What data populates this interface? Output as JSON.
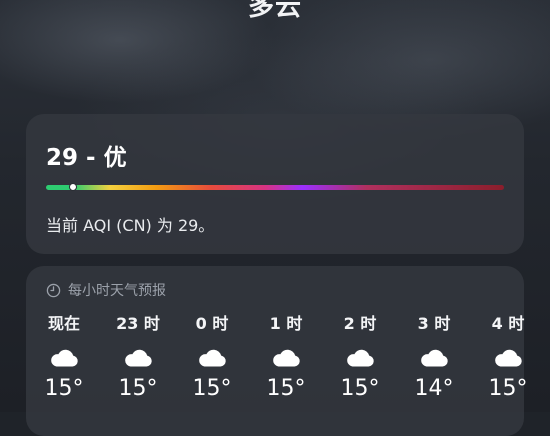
{
  "header": {
    "condition": "多云"
  },
  "aqi": {
    "title": "29 - 优",
    "value": 29,
    "scale_max": 500,
    "description": "当前 AQI (CN) 为 29。"
  },
  "hourly": {
    "header_icon": "clock-icon",
    "title": "每小时天气预报",
    "items": [
      {
        "label": "现在",
        "icon": "cloud-icon",
        "temp": "15°"
      },
      {
        "label": "23 时",
        "icon": "cloud-icon",
        "temp": "15°"
      },
      {
        "label": "0 时",
        "icon": "cloud-icon",
        "temp": "15°"
      },
      {
        "label": "1 时",
        "icon": "cloud-icon",
        "temp": "15°"
      },
      {
        "label": "2 时",
        "icon": "cloud-icon",
        "temp": "15°"
      },
      {
        "label": "3 时",
        "icon": "cloud-icon",
        "temp": "14°"
      },
      {
        "label": "4 时",
        "icon": "cloud-icon",
        "temp": "15°"
      }
    ]
  }
}
